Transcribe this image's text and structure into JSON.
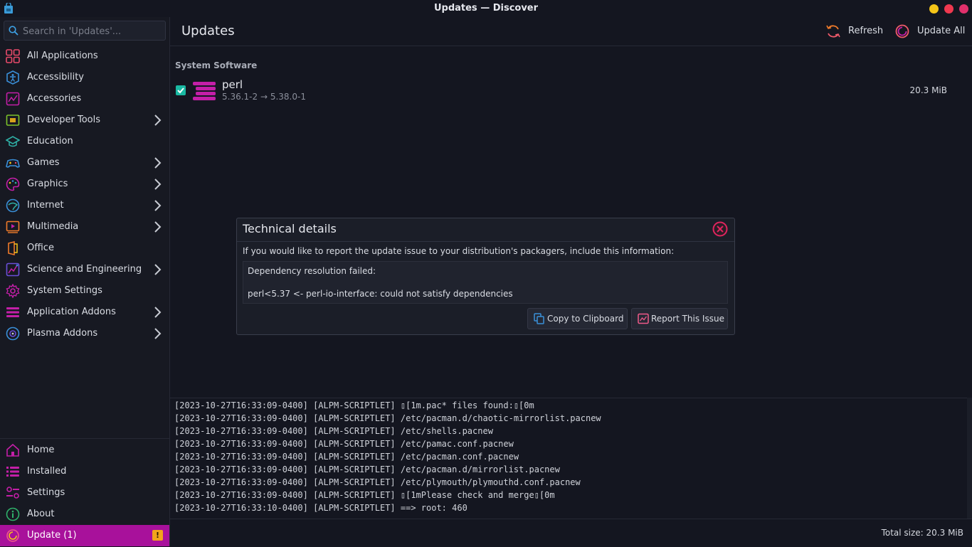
{
  "window": {
    "title": "Updates — Discover"
  },
  "search": {
    "placeholder": "Search in 'Updates'..."
  },
  "sidebar": {
    "categories": [
      {
        "label": "All Applications",
        "icon": "grid-icon"
      },
      {
        "label": "Accessibility",
        "icon": "accessibility-icon"
      },
      {
        "label": "Accessories",
        "icon": "accessories-icon"
      },
      {
        "label": "Developer Tools",
        "icon": "developer-tools-icon",
        "has_children": true
      },
      {
        "label": "Education",
        "icon": "graduation-cap-icon"
      },
      {
        "label": "Games",
        "icon": "gamepad-icon",
        "has_children": true
      },
      {
        "label": "Graphics",
        "icon": "palette-icon",
        "has_children": true
      },
      {
        "label": "Internet",
        "icon": "globe-icon",
        "has_children": true
      },
      {
        "label": "Multimedia",
        "icon": "play-icon",
        "has_children": true
      },
      {
        "label": "Office",
        "icon": "office-icon"
      },
      {
        "label": "Science and Engineering",
        "icon": "science-icon",
        "has_children": true
      },
      {
        "label": "System Settings",
        "icon": "gear-icon"
      },
      {
        "label": "Application Addons",
        "icon": "addons-icon",
        "has_children": true
      },
      {
        "label": "Plasma Addons",
        "icon": "plasma-icon",
        "has_children": true
      }
    ],
    "nav": [
      {
        "label": "Home",
        "icon": "home-icon"
      },
      {
        "label": "Installed",
        "icon": "list-icon"
      },
      {
        "label": "Settings",
        "icon": "settings-sliders-icon"
      },
      {
        "label": "About",
        "icon": "info-icon"
      },
      {
        "label": "Update (1)",
        "icon": "update-icon",
        "active": true,
        "badge": "!"
      }
    ]
  },
  "header": {
    "title": "Updates",
    "refresh_label": "Refresh",
    "update_all_label": "Update All"
  },
  "updates": {
    "section_title": "System Software",
    "packages": [
      {
        "name": "perl",
        "version": "5.36.1-2 → 5.38.0-1",
        "size": "20.3 MiB",
        "checked": true
      }
    ]
  },
  "dialog": {
    "title": "Technical details",
    "message": "If you would like to report the update issue to your distribution's packagers, include this information:",
    "details_line1": "Dependency resolution failed:",
    "details_line2": "perl<5.37 <- perl-io-interface: could not satisfy dependencies",
    "copy_label": "Copy to Clipboard",
    "report_label": "Report This Issue"
  },
  "log": [
    "[2023-10-27T16:33:09-0400] [ALPM-SCRIPTLET] ▯[1m.pac* files found:▯[0m",
    "[2023-10-27T16:33:09-0400] [ALPM-SCRIPTLET] /etc/pacman.d/chaotic-mirrorlist.pacnew",
    "[2023-10-27T16:33:09-0400] [ALPM-SCRIPTLET] /etc/shells.pacnew",
    "[2023-10-27T16:33:09-0400] [ALPM-SCRIPTLET] /etc/pamac.conf.pacnew",
    "[2023-10-27T16:33:09-0400] [ALPM-SCRIPTLET] /etc/pacman.conf.pacnew",
    "[2023-10-27T16:33:09-0400] [ALPM-SCRIPTLET] /etc/pacman.d/mirrorlist.pacnew",
    "[2023-10-27T16:33:09-0400] [ALPM-SCRIPTLET] /etc/plymouth/plymouthd.conf.pacnew",
    "[2023-10-27T16:33:09-0400] [ALPM-SCRIPTLET] ▯[1mPlease check and merge▯[0m",
    "[2023-10-27T16:33:10-0400] [ALPM-SCRIPTLET] ==> root: 460"
  ],
  "footer": {
    "total_size": "Total size: 20.3 MiB"
  },
  "colors": {
    "accent": "#a8119b",
    "badge": "#f2a41c",
    "checkbox": "#1ab9a3",
    "close": "#e0245e"
  }
}
